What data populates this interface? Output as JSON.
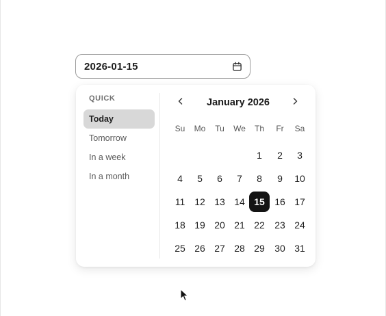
{
  "date_input": {
    "value": "2026-01-15",
    "icon": "calendar-icon"
  },
  "quick": {
    "title": "QUICK",
    "items": [
      {
        "label": "Today",
        "active": true
      },
      {
        "label": "Tomorrow",
        "active": false
      },
      {
        "label": "In a week",
        "active": false
      },
      {
        "label": "In a month",
        "active": false
      }
    ]
  },
  "calendar": {
    "month_title": "January 2026",
    "prev_icon": "chevron-left-icon",
    "next_icon": "chevron-right-icon",
    "weekdays": [
      "Su",
      "Mo",
      "Tu",
      "We",
      "Th",
      "Fr",
      "Sa"
    ],
    "weeks": [
      [
        "",
        "",
        "",
        "",
        "1",
        "2",
        "3"
      ],
      [
        "4",
        "5",
        "6",
        "7",
        "8",
        "9",
        "10"
      ],
      [
        "11",
        "12",
        "13",
        "14",
        "15",
        "16",
        "17"
      ],
      [
        "18",
        "19",
        "20",
        "21",
        "22",
        "23",
        "24"
      ],
      [
        "25",
        "26",
        "27",
        "28",
        "29",
        "30",
        "31"
      ]
    ],
    "selected_day": "15"
  },
  "colors": {
    "selected_bg": "#141414",
    "quick_active_bg": "#d8d8d8",
    "input_border": "#9a9a9a"
  }
}
